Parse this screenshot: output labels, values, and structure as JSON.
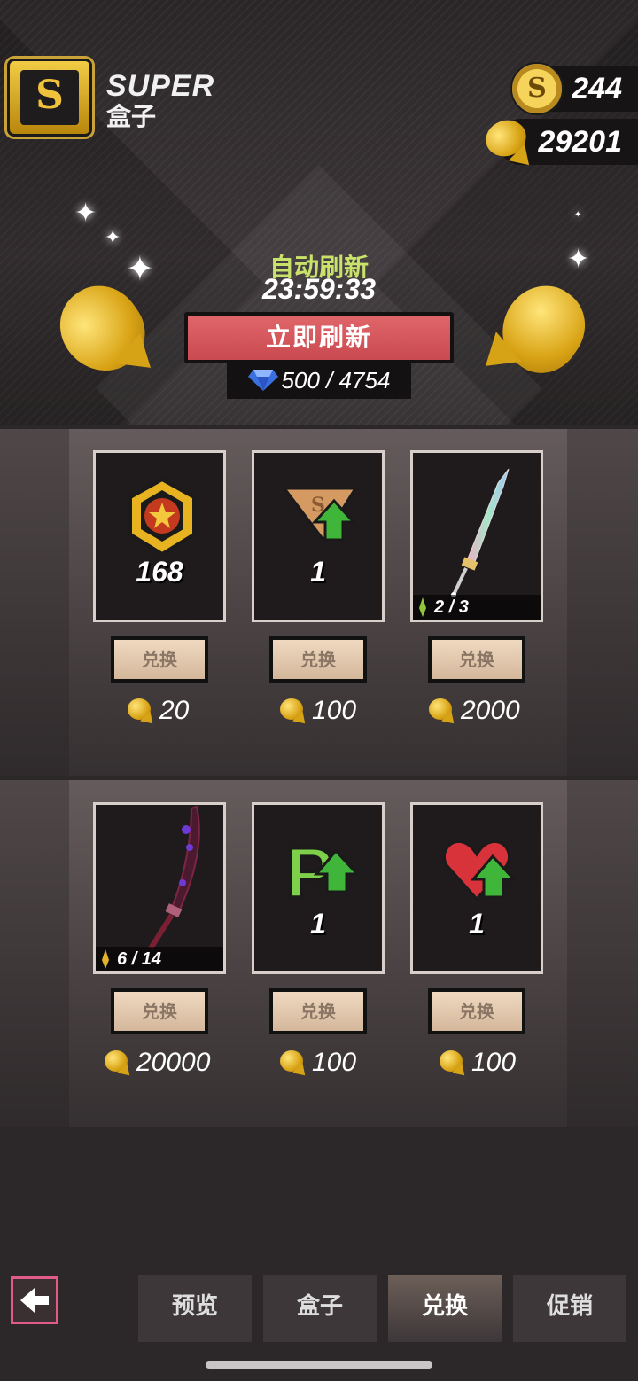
{
  "header": {
    "logo_letter": "S",
    "logo_title": "SUPER",
    "logo_subtitle": "盒子",
    "currencies": [
      {
        "icon": "s-coin-icon",
        "value": "244"
      },
      {
        "icon": "golden-fish-icon",
        "value": "29201"
      }
    ],
    "refresh_label": "自动刷新",
    "refresh_timer": "23:59:33",
    "refresh_button": "立即刷新",
    "refresh_cost": "500 / 4754"
  },
  "items": [
    {
      "icon": "star-medal-icon",
      "qty": "168",
      "button": "兑换",
      "price": "20"
    },
    {
      "icon": "rank-upgrade-icon",
      "qty": "1",
      "button": "兑换",
      "price": "100"
    },
    {
      "icon": "rainbow-sword-icon",
      "progress": "2 / 3",
      "button": "兑换",
      "price": "2000"
    },
    {
      "icon": "dark-katana-icon",
      "progress": "6 / 14",
      "button": "兑换",
      "price": "20000"
    },
    {
      "icon": "p-upgrade-icon",
      "qty": "1",
      "button": "兑换",
      "price": "100"
    },
    {
      "icon": "heart-upgrade-icon",
      "qty": "1",
      "button": "兑换",
      "price": "100"
    }
  ],
  "tabs": [
    "预览",
    "盒子",
    "兑换",
    "促销"
  ],
  "active_tab": "兑换",
  "colors": {
    "accent_green": "#c8e26a",
    "refresh_button": "#d85a5f",
    "gold": "#e5b12a",
    "back_border": "#e25a88"
  }
}
